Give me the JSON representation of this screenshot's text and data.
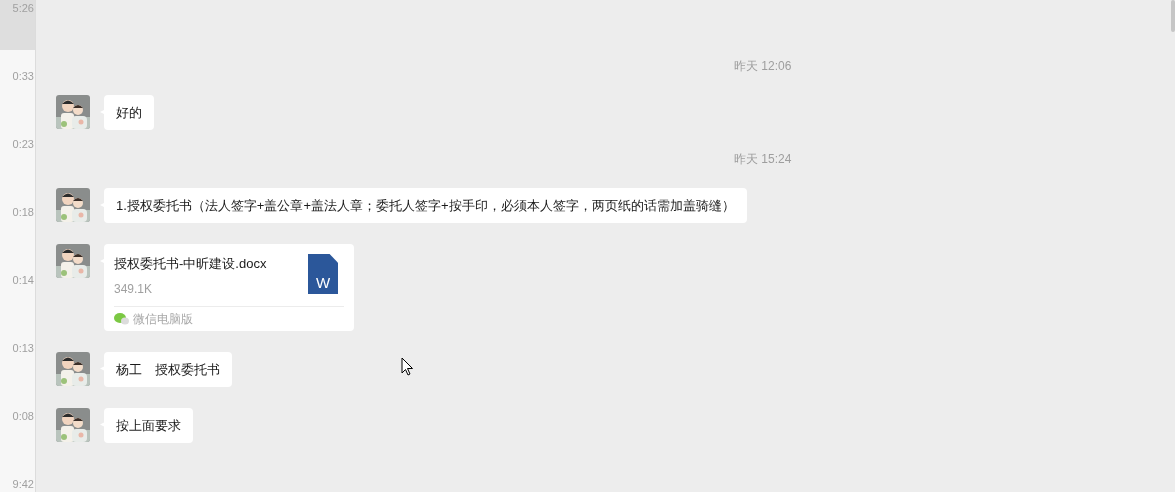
{
  "sidebar": {
    "items": [
      {
        "time": "5:26",
        "selected": true
      },
      {
        "time": "0:33",
        "selected": false
      },
      {
        "time": "0:23",
        "selected": false
      },
      {
        "time": "0:18",
        "selected": false
      },
      {
        "time": "0:14",
        "selected": false
      },
      {
        "time": "0:13",
        "selected": false
      },
      {
        "time": "0:08",
        "selected": false
      },
      {
        "time": "9:42",
        "selected": false
      }
    ]
  },
  "messages": [
    {
      "kind": "timestamp",
      "text": "昨天 12:06"
    },
    {
      "kind": "text",
      "text": "好的"
    },
    {
      "kind": "timestamp",
      "text": "昨天 15:24"
    },
    {
      "kind": "text",
      "text": "1.授权委托书（法人签字+盖公章+盖法人章；委托人签字+按手印，必须本人签字，两页纸的话需加盖骑缝）"
    },
    {
      "kind": "file",
      "name": "授权委托书-中昕建设.docx",
      "size": "349.1K",
      "file_icon": "W",
      "source": "微信电脑版"
    },
    {
      "kind": "text",
      "text": "杨工　授权委托书"
    },
    {
      "kind": "text",
      "text": "按上面要求"
    }
  ]
}
